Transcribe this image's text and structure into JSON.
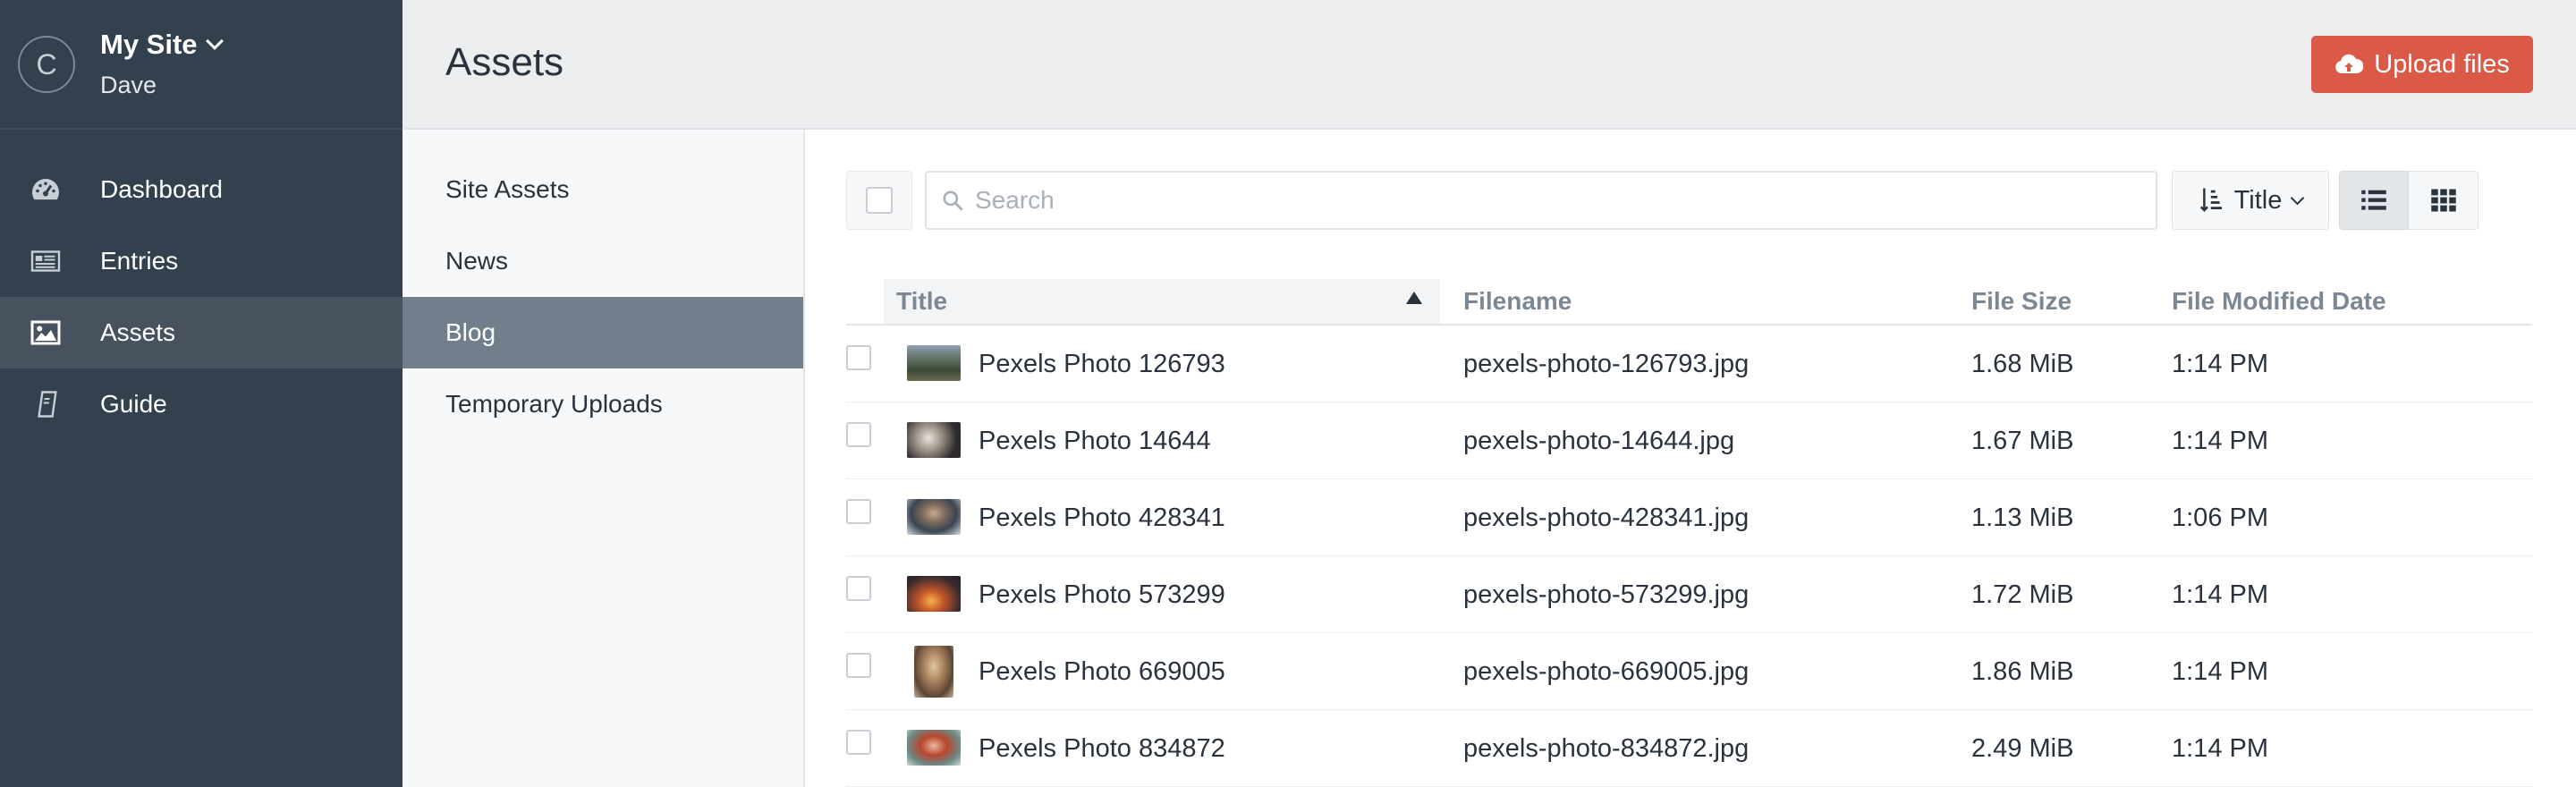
{
  "site": {
    "logo_letter": "C",
    "name": "My Site",
    "user": "Dave"
  },
  "nav": {
    "items": [
      {
        "label": "Dashboard",
        "icon": "dashboard-icon"
      },
      {
        "label": "Entries",
        "icon": "entries-icon"
      },
      {
        "label": "Assets",
        "icon": "image-icon",
        "active": true
      },
      {
        "label": "Guide",
        "icon": "guide-icon"
      }
    ]
  },
  "header": {
    "title": "Assets",
    "upload_label": "Upload files"
  },
  "sources": {
    "items": [
      {
        "label": "Site Assets"
      },
      {
        "label": "News"
      },
      {
        "label": "Blog",
        "active": true
      },
      {
        "label": "Temporary Uploads"
      }
    ]
  },
  "toolbar": {
    "search_placeholder": "Search",
    "sort_label": "Title",
    "view_mode": "list"
  },
  "table": {
    "columns": [
      "Title",
      "Filename",
      "File Size",
      "File Modified Date"
    ],
    "sort_column": "Title",
    "sort_direction": "ascending",
    "rows": [
      {
        "title": "Pexels Photo 126793",
        "filename": "pexels-photo-126793.jpg",
        "size": "1.68 MiB",
        "date": "1:14 PM"
      },
      {
        "title": "Pexels Photo 14644",
        "filename": "pexels-photo-14644.jpg",
        "size": "1.67 MiB",
        "date": "1:14 PM"
      },
      {
        "title": "Pexels Photo 428341",
        "filename": "pexels-photo-428341.jpg",
        "size": "1.13 MiB",
        "date": "1:06 PM"
      },
      {
        "title": "Pexels Photo 573299",
        "filename": "pexels-photo-573299.jpg",
        "size": "1.72 MiB",
        "date": "1:14 PM"
      },
      {
        "title": "Pexels Photo 669005",
        "filename": "pexels-photo-669005.jpg",
        "size": "1.86 MiB",
        "date": "1:14 PM"
      },
      {
        "title": "Pexels Photo 834872",
        "filename": "pexels-photo-834872.jpg",
        "size": "2.49 MiB",
        "date": "1:14 PM"
      }
    ]
  },
  "colors": {
    "sidebar_bg": "#33404d",
    "accent_red": "#da5a47",
    "source_active_bg": "#717f8d"
  }
}
